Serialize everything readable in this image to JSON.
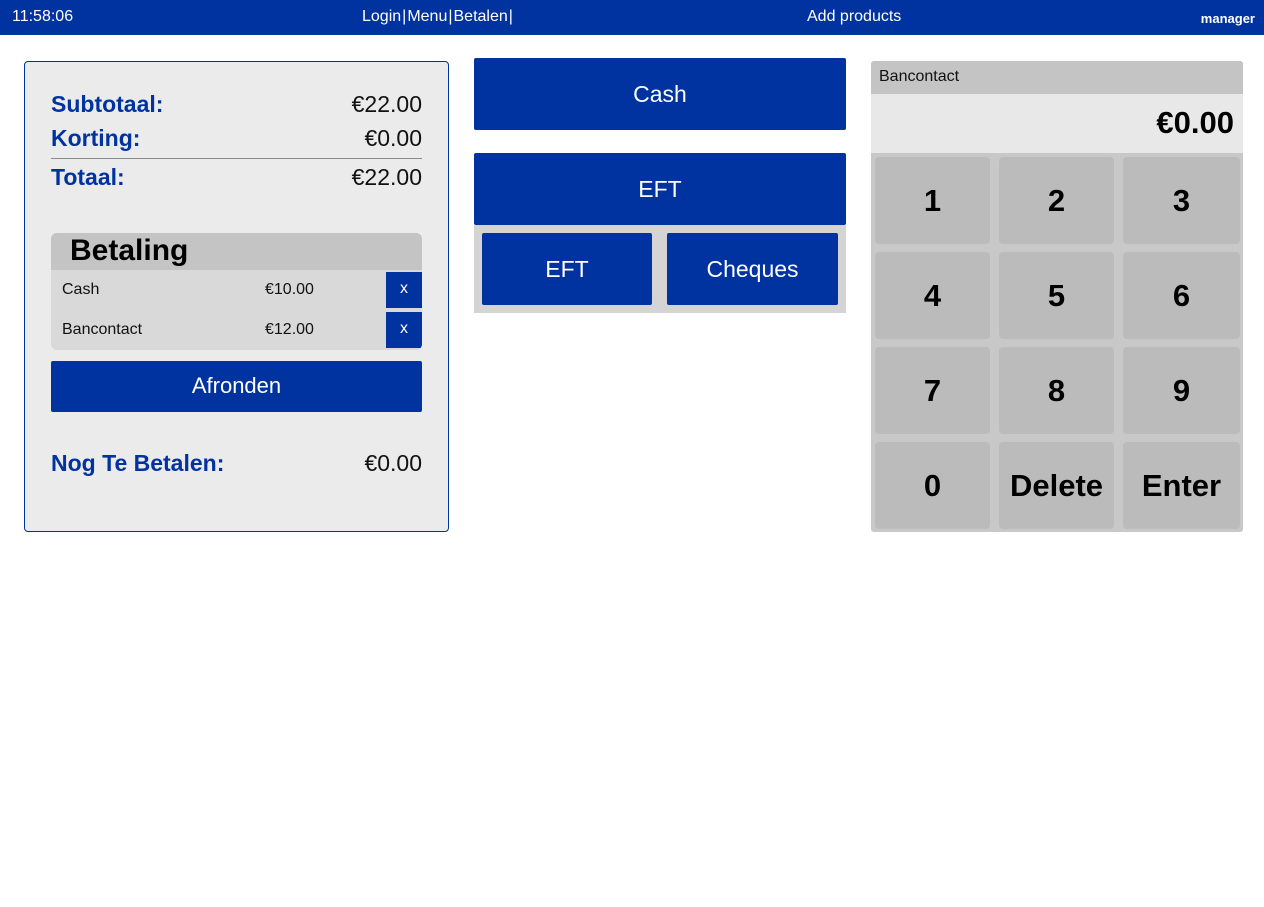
{
  "topbar": {
    "time": "11:58:06",
    "nav": [
      "Login",
      "Menu",
      "Betalen"
    ],
    "separator": "|",
    "title": "Add products",
    "user": "manager"
  },
  "summary": {
    "subtotal_label": "Subtotaal:",
    "subtotal_value": "€22.00",
    "korting_label": "Korting:",
    "korting_value": "€0.00",
    "totaal_label": "Totaal:",
    "totaal_value": "€22.00",
    "betaling_title": "Betaling",
    "payments": [
      {
        "method": "Cash",
        "amount": "€10.00",
        "remove": "x"
      },
      {
        "method": "Bancontact",
        "amount": "€12.00",
        "remove": "x"
      }
    ],
    "afronden_label": "Afronden",
    "nog_label": "Nog Te Betalen:",
    "nog_value": "€0.00"
  },
  "methods": {
    "cash": "Cash",
    "eft_main": "EFT",
    "eft_sub": "EFT",
    "cheques": "Cheques"
  },
  "keypad": {
    "method": "Bancontact",
    "display": "€0.00",
    "keys": [
      "1",
      "2",
      "3",
      "4",
      "5",
      "6",
      "7",
      "8",
      "9",
      "0",
      "Delete",
      "Enter"
    ]
  },
  "colors": {
    "brand": "#0033a0",
    "panel_bg": "#ebebeb",
    "key_bg": "#bbbbbb"
  }
}
